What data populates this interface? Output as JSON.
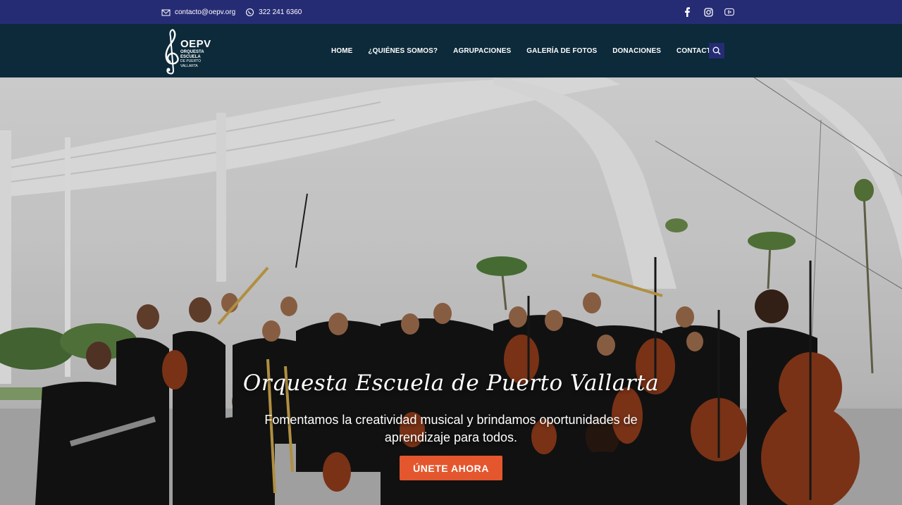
{
  "topbar": {
    "email": "contacto@oepv.org",
    "phone": "322 241 6360",
    "icons": [
      "mail-icon",
      "whatsapp-icon"
    ],
    "social": [
      "facebook-icon",
      "instagram-icon",
      "youtube-icon"
    ],
    "bg_color": "#262c74"
  },
  "header": {
    "bg_color": "#0c2a3a",
    "logo": {
      "brand": "OEPV",
      "line1": "ORQUESTA",
      "line2": "ESCUELA",
      "line3": "DE PUERTO",
      "line4": "VALLARTA"
    },
    "nav": [
      {
        "label": "HOME"
      },
      {
        "label": "¿QUIÉNES SOMOS?"
      },
      {
        "label": "AGRUPACIONES"
      },
      {
        "label": "GALERÍA DE FOTOS"
      },
      {
        "label": "DONACIONES"
      },
      {
        "label": "CONTACTO"
      }
    ],
    "search_icon": "search-icon"
  },
  "hero": {
    "title": "Orquesta Escuela de Puerto Vallarta",
    "text": "Fomentamos la creatividad musical y brindamos oportunidades de aprendizaje para todos.",
    "cta_label": "ÚNETE AHORA",
    "cta_color": "#e4572e"
  }
}
